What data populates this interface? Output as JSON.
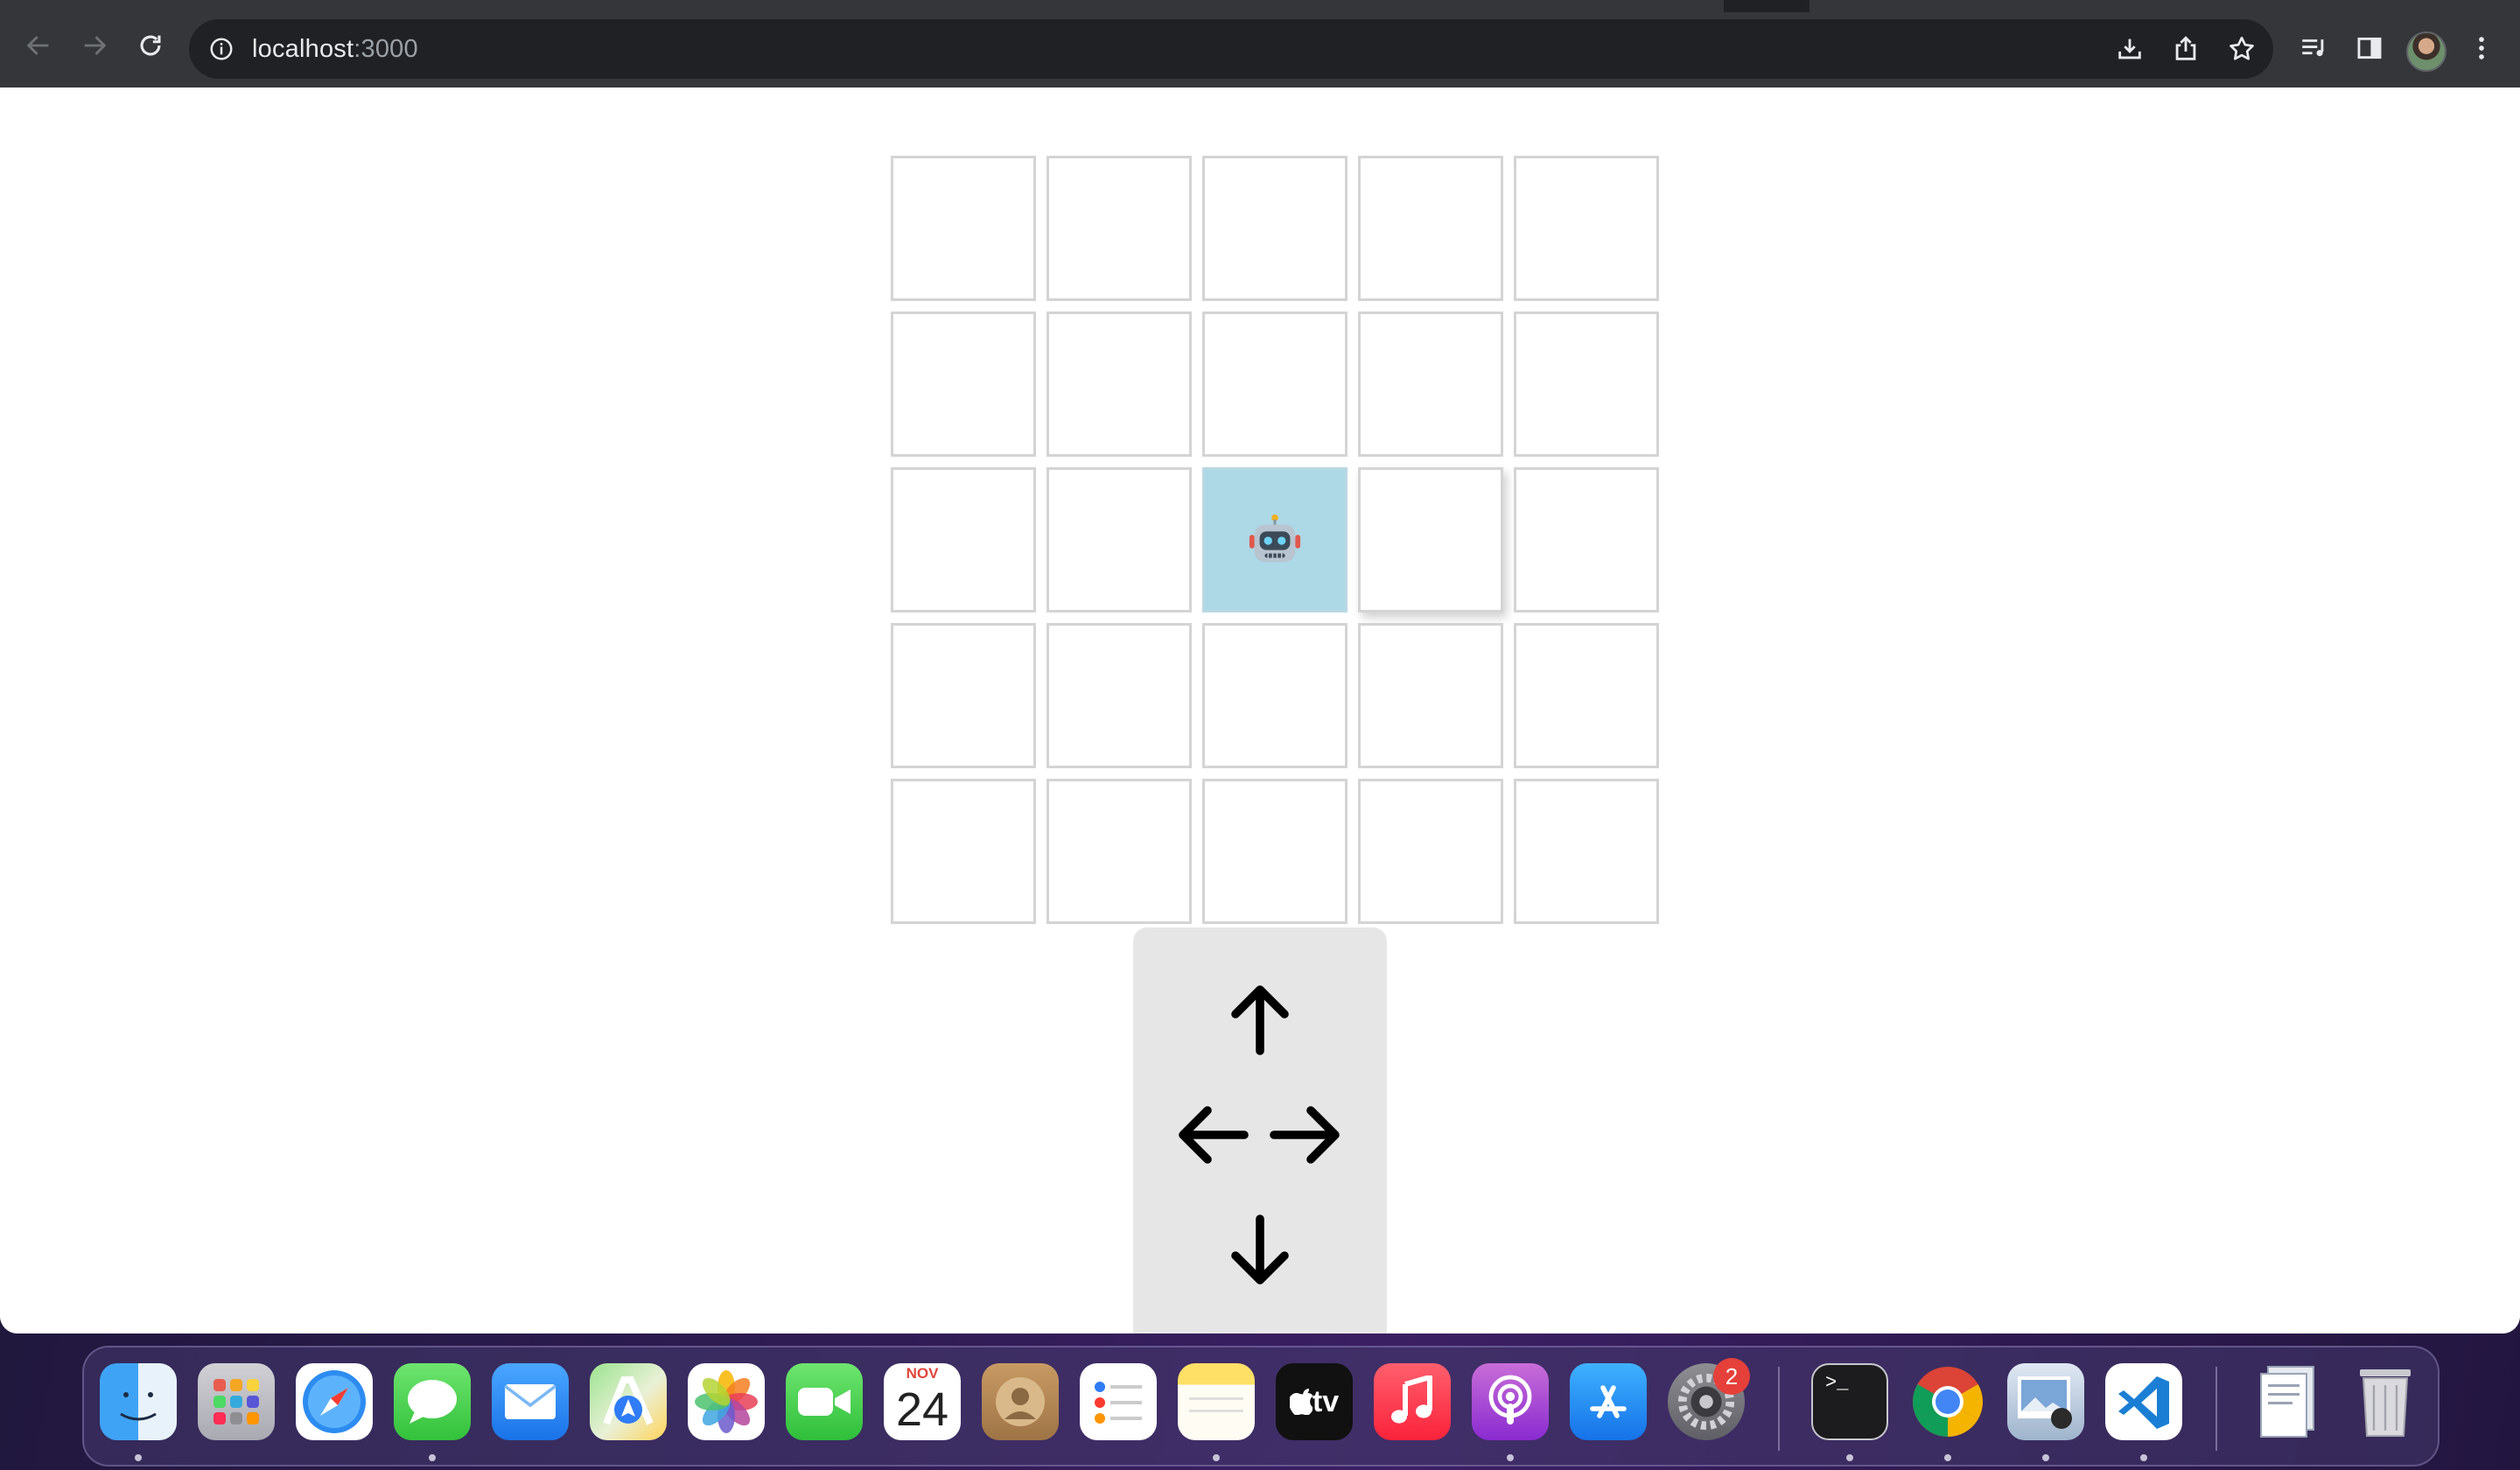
{
  "browser": {
    "url_host": "localhost",
    "url_port": ":3000"
  },
  "icons": {
    "back": "arrow-left-icon",
    "forward": "arrow-right-icon",
    "reload": "reload-icon",
    "info": "info-icon",
    "install": "install-app-icon",
    "share": "share-icon",
    "bookmark": "star-icon",
    "media": "media-control-icon",
    "side_panel": "side-panel-icon",
    "menu": "kebab-menu-icon"
  },
  "grid": {
    "rows": 5,
    "cols": 5,
    "robot_row": 3,
    "robot_col": 3,
    "robot_symbol": "robot-icon",
    "active_color": "#add8e6"
  },
  "controls": {
    "up": "arrow-up",
    "left": "arrow-left",
    "right": "arrow-right",
    "down": "arrow-down"
  },
  "dock": {
    "calendar_month": "NOV",
    "calendar_day": "24",
    "tv_label": "tv",
    "settings_badge": "2",
    "terminal_prompt": ">_",
    "apps": [
      "Finder",
      "Launchpad",
      "Safari",
      "Messages",
      "Mail",
      "Maps",
      "Photos",
      "FaceTime",
      "Calendar",
      "Contacts",
      "Reminders",
      "Notes",
      "TV",
      "Music",
      "Podcasts",
      "App Store",
      "System Settings",
      "Terminal",
      "Chrome",
      "Preview",
      "VS Code",
      "Documents",
      "Trash"
    ]
  }
}
